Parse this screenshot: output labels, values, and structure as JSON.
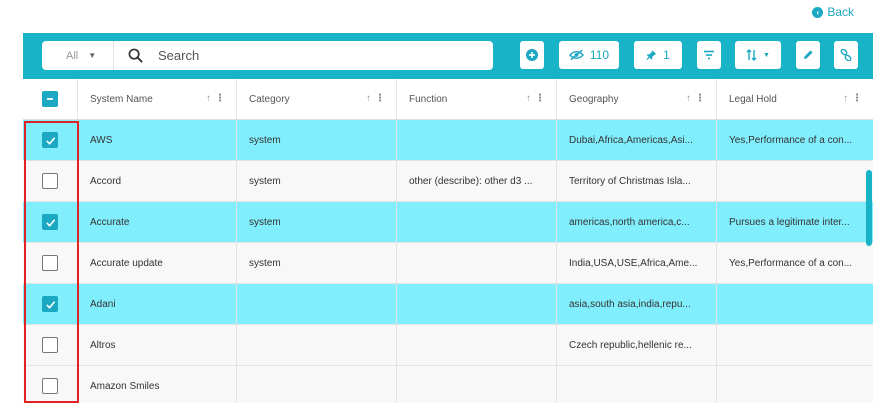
{
  "back": {
    "label": "Back",
    "icon": "chevron-left-circle-icon"
  },
  "toolbar": {
    "scope_value": "All",
    "search_label": "Search",
    "hidden_count": "110",
    "pinned_count": "1"
  },
  "colors": {
    "accent": "#19b3c8",
    "selected_row": "#80eefc",
    "highlight": "#e02424"
  },
  "table": {
    "columns": [
      "System Name",
      "Category",
      "Function",
      "Geography",
      "Legal Hold"
    ],
    "header_checkbox": "indeterminate",
    "rows": [
      {
        "checked": true,
        "name": "AWS",
        "category": "system",
        "function": "",
        "geography": "Dubai,Africa,Americas,Asi...",
        "legal_hold": "Yes,Performance of a con..."
      },
      {
        "checked": false,
        "name": "Accord",
        "category": "system",
        "function": "other (describe): other d3 ...",
        "geography": "Territory of Christmas Isla...",
        "legal_hold": ""
      },
      {
        "checked": true,
        "name": "Accurate",
        "category": "system",
        "function": "",
        "geography": "americas,north america,c...",
        "legal_hold": "Pursues a legitimate inter..."
      },
      {
        "checked": false,
        "name": "Accurate update",
        "category": "system",
        "function": "",
        "geography": "India,USA,USE,Africa,Ame...",
        "legal_hold": "Yes,Performance of a con..."
      },
      {
        "checked": true,
        "name": "Adani",
        "category": "",
        "function": "",
        "geography": "asia,south asia,india,repu...",
        "legal_hold": ""
      },
      {
        "checked": false,
        "name": "Altros",
        "category": "",
        "function": "",
        "geography": "Czech republic,hellenic re...",
        "legal_hold": ""
      },
      {
        "checked": false,
        "name": "Amazon Smiles",
        "category": "",
        "function": "",
        "geography": "",
        "legal_hold": ""
      }
    ]
  }
}
